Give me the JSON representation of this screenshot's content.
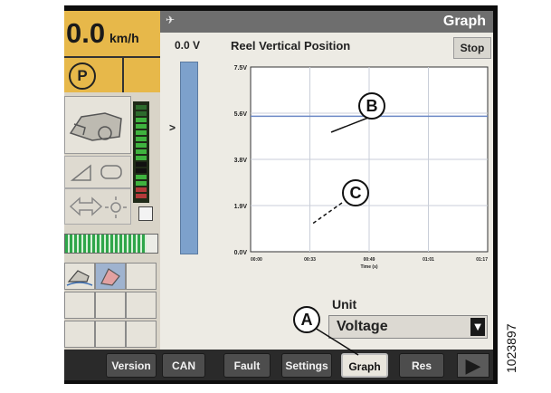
{
  "left_panel": {
    "speed_value": "0.0",
    "speed_unit": "km/h",
    "park_symbol": "P",
    "horizontal_bar_level": 0.88
  },
  "graph_window": {
    "title": "Graph",
    "voltage_readout": "0.0 V",
    "chart_title": "Reel Vertical Position",
    "stop_label": "Stop",
    "unit_label": "Unit",
    "unit_value": "Voltage"
  },
  "chart_data": {
    "type": "line",
    "title": "Reel Vertical Position",
    "xlabel": "Time (s)",
    "ylabel": "",
    "y_ticks": [
      "7.5V",
      "5.6V",
      "3.8V",
      "1.9V",
      "0.0V"
    ],
    "x_ticks": [
      "00:00",
      "00:33",
      "00:49",
      "01:01",
      "01:17"
    ],
    "ylim": [
      0,
      7.5
    ],
    "grid": true,
    "series": [
      {
        "color": "#6b88c6",
        "x": [
          0,
          1
        ],
        "y": [
          5.5,
          5.5
        ]
      }
    ]
  },
  "tabs": [
    {
      "label": "Version",
      "active": false
    },
    {
      "label": "CAN",
      "active": false
    },
    {
      "label": "Fault",
      "active": false
    },
    {
      "label": "Settings",
      "active": false
    },
    {
      "label": "Graph",
      "active": true
    },
    {
      "label": "Res",
      "active": false
    }
  ],
  "callouts": {
    "a": "A",
    "b": "B",
    "c": "C"
  },
  "figure_id": "1023897",
  "colors": {
    "accent": "#e7b84a",
    "line": "#6b88c6",
    "bar": "#7da1cc"
  }
}
